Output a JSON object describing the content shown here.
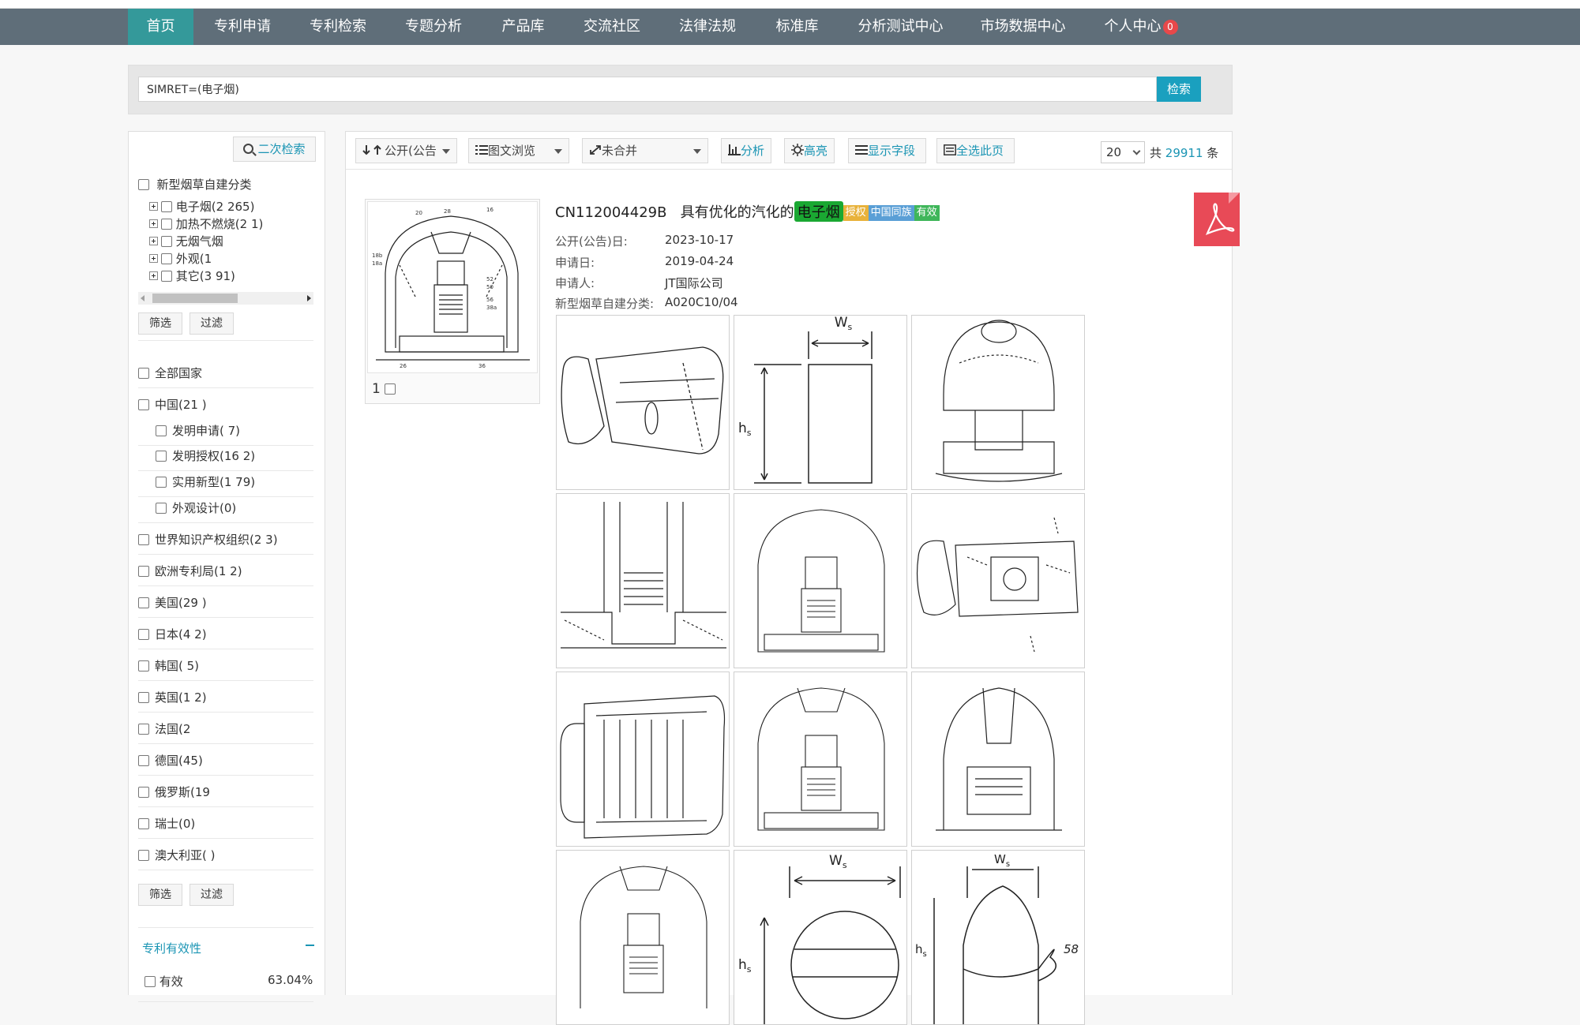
{
  "nav": {
    "items": [
      {
        "label": "首页",
        "active": true
      },
      {
        "label": "专利申请"
      },
      {
        "label": "专利检索"
      },
      {
        "label": "专题分析"
      },
      {
        "label": "产品库"
      },
      {
        "label": "交流社区"
      },
      {
        "label": "法律法规"
      },
      {
        "label": "标准库"
      },
      {
        "label": "分析测试中心"
      },
      {
        "label": "市场数据中心"
      },
      {
        "label": "个人中心"
      }
    ],
    "badge_count": "0"
  },
  "search": {
    "query": "SIMRET=(电子烟)",
    "button_label": "检索"
  },
  "sidebar": {
    "secondary_search_label": "二次检索",
    "category_title": "新型烟草自建分类",
    "categories": [
      {
        "label": "电子烟(2  265)"
      },
      {
        "label": "加热不燃烧(2   1)"
      },
      {
        "label": "无烟气烟"
      },
      {
        "label": "外观(1"
      },
      {
        "label": "其它(3  91)"
      }
    ],
    "filter_label": "筛选",
    "exclude_label": "过滤",
    "countries": [
      {
        "label": "全部国家",
        "indent": 0
      },
      {
        "label": "中国(21  )",
        "indent": 0
      },
      {
        "label": "发明申请(   7)",
        "indent": 1
      },
      {
        "label": "发明授权(16  2)",
        "indent": 1
      },
      {
        "label": "实用新型(1   79)",
        "indent": 1
      },
      {
        "label": "外观设计(0)",
        "indent": 1
      },
      {
        "label": "世界知识产权组织(2   3)",
        "indent": 0
      },
      {
        "label": "欧洲专利局(1   2)",
        "indent": 0
      },
      {
        "label": "美国(29  )",
        "indent": 0
      },
      {
        "label": "日本(4  2)",
        "indent": 0
      },
      {
        "label": "韩国(   5)",
        "indent": 0
      },
      {
        "label": "英国(1  2)",
        "indent": 0
      },
      {
        "label": "法国(2",
        "indent": 0
      },
      {
        "label": "德国(45)",
        "indent": 0
      },
      {
        "label": "俄罗斯(19",
        "indent": 0
      },
      {
        "label": "瑞士(0)",
        "indent": 0
      },
      {
        "label": "澳大利亚(  )",
        "indent": 0
      }
    ],
    "validity_title": "专利有效性",
    "validity_items": [
      {
        "label": "有效",
        "pct": "63.04%"
      }
    ]
  },
  "toolbar": {
    "sort_label": "公开(公告",
    "view_label": "图文浏览",
    "merge_label": "未合并",
    "analyze_label": "分析",
    "highlight_label": "高亮",
    "fields_label": "显示字段",
    "select_page_label": "全选此页",
    "page_size": "20",
    "total_prefix": "共",
    "total_count": "29911",
    "total_suffix": "条"
  },
  "result": {
    "index": "1",
    "pub_no": "CN112004429B",
    "title_prefix": "具有优化的汽化的",
    "title_highlight": "电子烟",
    "tags": [
      {
        "label": "授权",
        "color": "#e8b23a"
      },
      {
        "label": "中国同族",
        "color": "#5a9fd6"
      },
      {
        "label": "有效",
        "color": "#3fb65a"
      }
    ],
    "meta": [
      {
        "label": "公开(公告)日:",
        "value": "2023-10-17"
      },
      {
        "label": "申请日:",
        "value": "2019-04-24"
      },
      {
        "label": "申请人:",
        "value": "JT国际公司"
      },
      {
        "label": "新型烟草自建分类:",
        "value": "A020C10/04"
      }
    ],
    "figure_labels": {
      "ws": "W",
      "ws_sub": "s",
      "hs": "h",
      "hs_sub": "s",
      "n58": "58"
    }
  }
}
